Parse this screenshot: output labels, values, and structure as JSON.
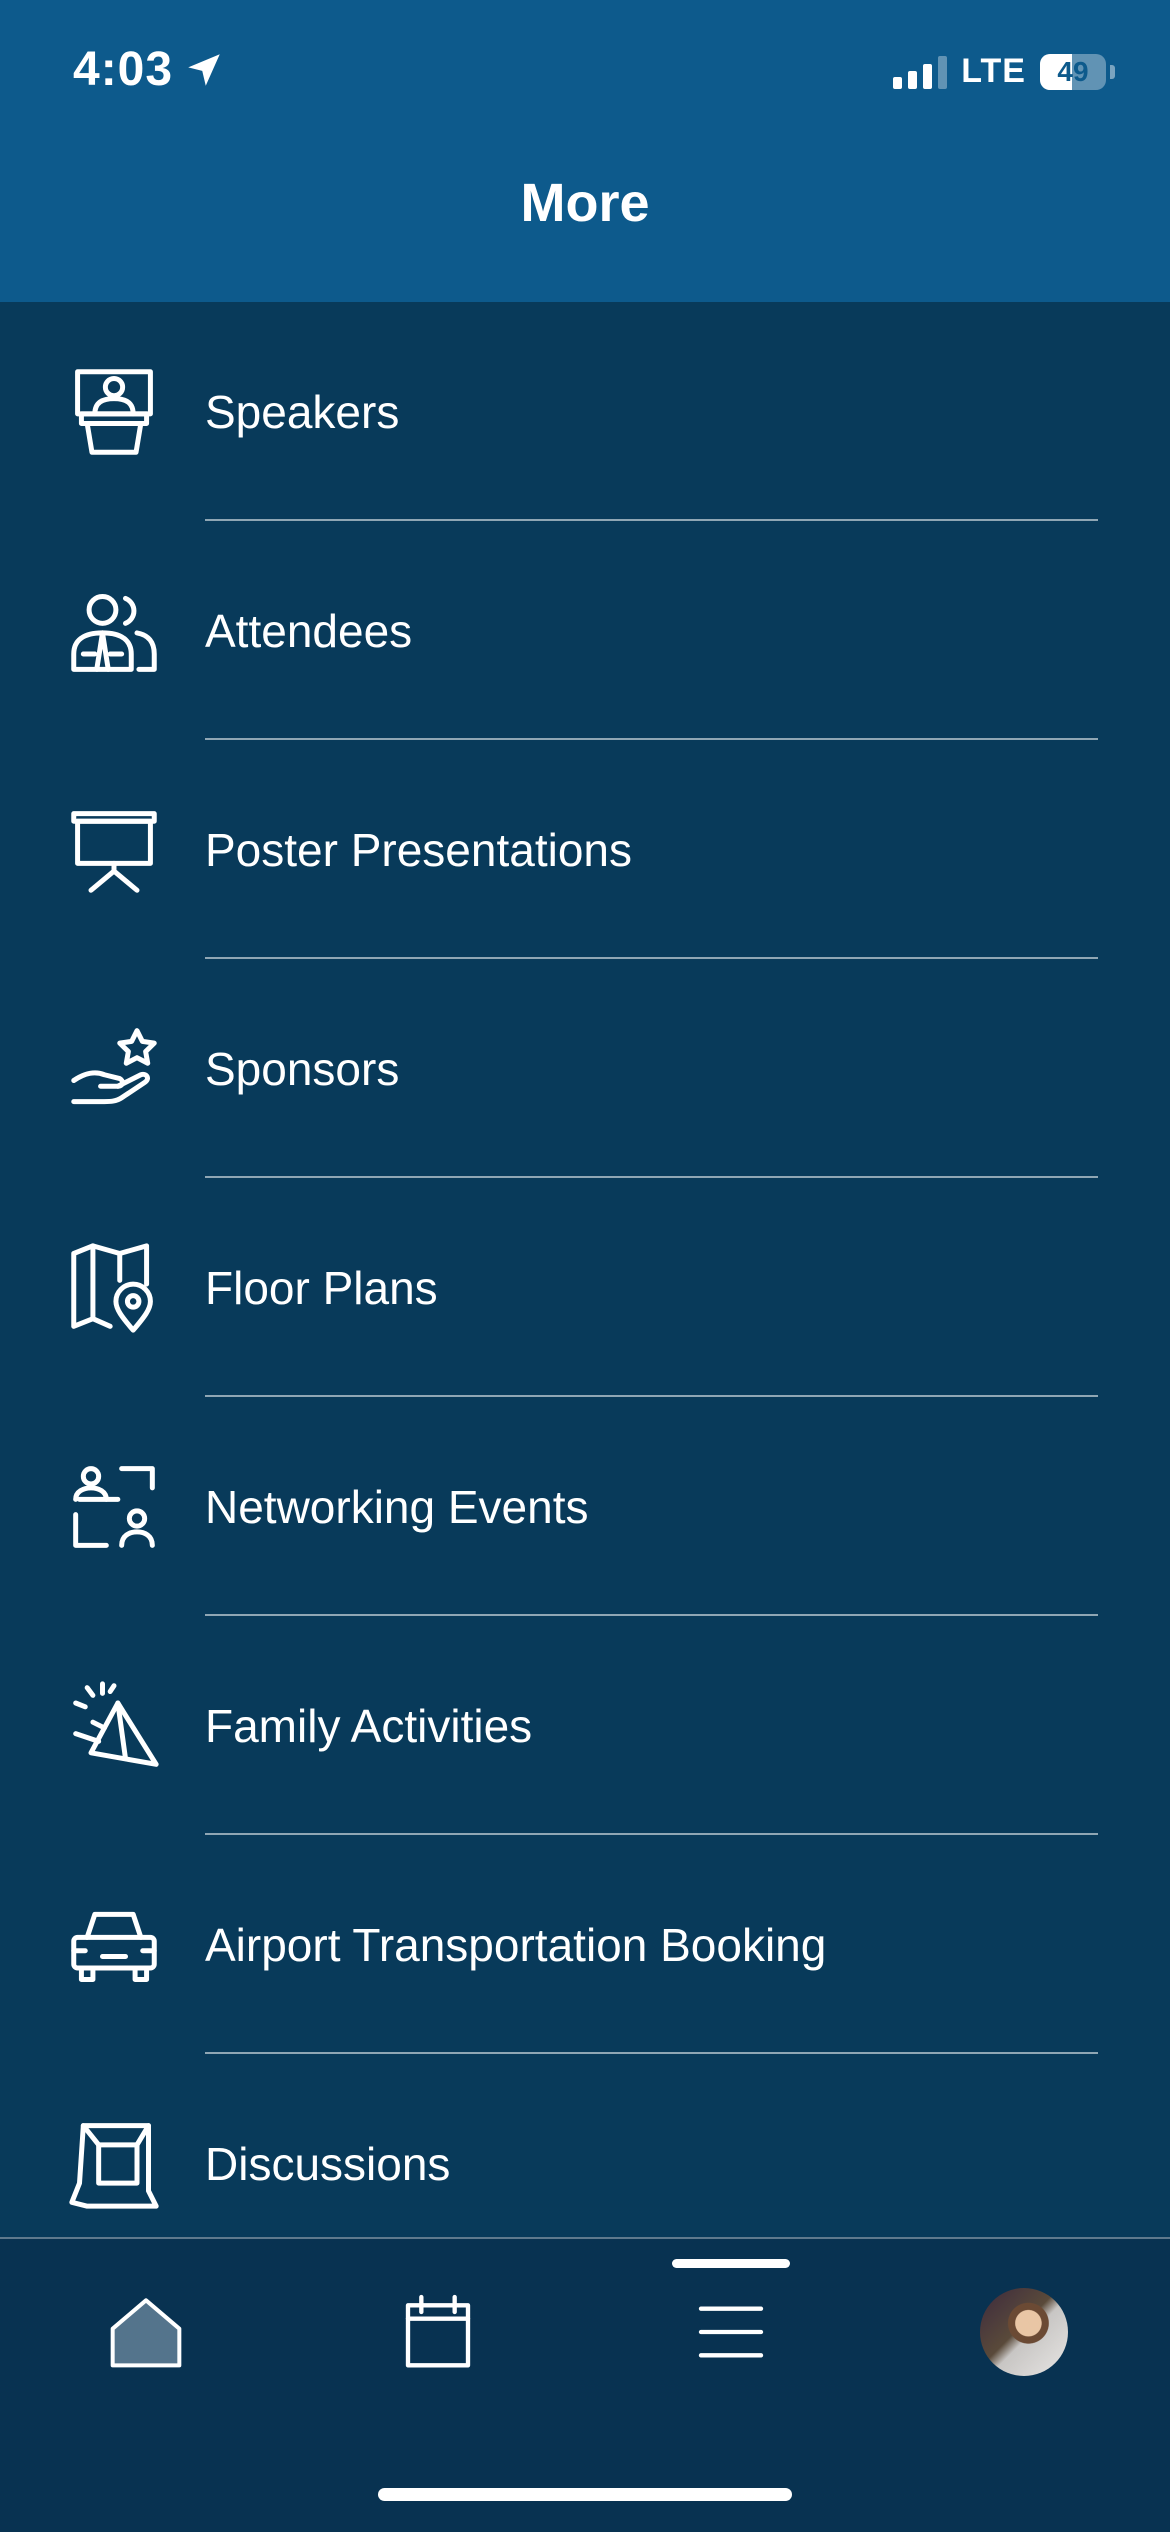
{
  "status": {
    "time": "4:03",
    "network": "LTE",
    "battery": "49"
  },
  "header": {
    "title": "More"
  },
  "menu": {
    "items": [
      {
        "label": "Speakers",
        "icon": "speaker-podium-icon"
      },
      {
        "label": "Attendees",
        "icon": "attendees-icon"
      },
      {
        "label": "Poster Presentations",
        "icon": "presentation-board-icon"
      },
      {
        "label": "Sponsors",
        "icon": "hand-star-icon"
      },
      {
        "label": "Floor Plans",
        "icon": "map-pin-icon"
      },
      {
        "label": "Networking Events",
        "icon": "networking-icon"
      },
      {
        "label": "Family Activities",
        "icon": "party-hat-icon"
      },
      {
        "label": "Airport Transportation Booking",
        "icon": "car-icon"
      },
      {
        "label": "Discussions",
        "icon": "discussion-icon"
      }
    ]
  },
  "tabbar": {
    "tabs": [
      {
        "name": "home",
        "icon": "home-icon"
      },
      {
        "name": "schedule",
        "icon": "calendar-icon"
      },
      {
        "name": "more",
        "icon": "menu-icon",
        "active": true
      },
      {
        "name": "profile",
        "icon": "avatar"
      }
    ]
  },
  "colors": {
    "header_bg": "#0d5a8c",
    "list_bg": "#083a5a",
    "tabbar_bg": "#083251",
    "text": "#ffffff"
  }
}
